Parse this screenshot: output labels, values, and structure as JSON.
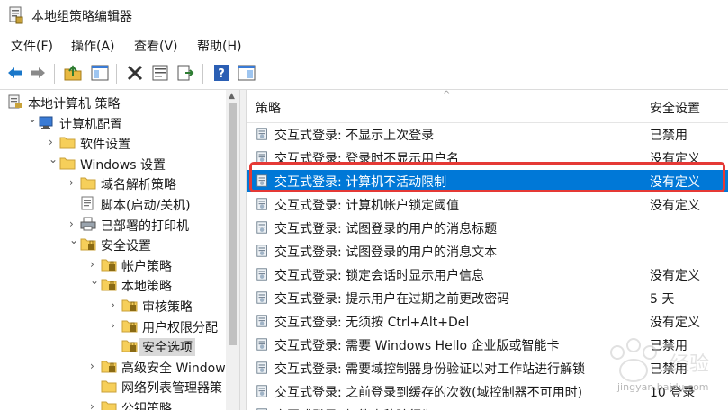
{
  "window": {
    "title": "本地组策略编辑器"
  },
  "menu": [
    "文件(F)",
    "操作(A)",
    "查看(V)",
    "帮助(H)"
  ],
  "tree": [
    {
      "label": "本地计算机 策略",
      "depth": 0,
      "chevron": "",
      "icon": "policy-doc-icon"
    },
    {
      "label": "计算机配置",
      "depth": 1,
      "chevron": "v",
      "icon": "computer-icon"
    },
    {
      "label": "软件设置",
      "depth": 2,
      "chevron": ">",
      "icon": "folder-icon"
    },
    {
      "label": "Windows 设置",
      "depth": 2,
      "chevron": "v",
      "icon": "folder-icon"
    },
    {
      "label": "域名解析策略",
      "depth": 3,
      "chevron": ">",
      "icon": "folder-icon"
    },
    {
      "label": "脚本(启动/关机)",
      "depth": 3,
      "chevron": "",
      "icon": "script-icon"
    },
    {
      "label": "已部署的打印机",
      "depth": 3,
      "chevron": ">",
      "icon": "printer-icon"
    },
    {
      "label": "安全设置",
      "depth": 3,
      "chevron": "v",
      "icon": "security-folder-icon"
    },
    {
      "label": "帐户策略",
      "depth": 4,
      "chevron": ">",
      "icon": "security-folder-icon"
    },
    {
      "label": "本地策略",
      "depth": 4,
      "chevron": "v",
      "icon": "security-folder-icon"
    },
    {
      "label": "审核策略",
      "depth": 5,
      "chevron": ">",
      "icon": "security-folder-icon"
    },
    {
      "label": "用户权限分配",
      "depth": 5,
      "chevron": ">",
      "icon": "security-folder-icon"
    },
    {
      "label": "安全选项",
      "depth": 5,
      "chevron": "",
      "icon": "security-folder-icon",
      "selected": true
    },
    {
      "label": "高级安全 Windows",
      "depth": 4,
      "chevron": ">",
      "icon": "security-folder-icon"
    },
    {
      "label": "网络列表管理器策",
      "depth": 4,
      "chevron": "",
      "icon": "folder-icon"
    },
    {
      "label": "公钥策略",
      "depth": 4,
      "chevron": ">",
      "icon": "folder-icon"
    }
  ],
  "list": {
    "col_policy": "策略",
    "col_setting": "安全设置",
    "rows": [
      {
        "name": "交互式登录: 不显示上次登录",
        "value": "已禁用"
      },
      {
        "name": "交互式登录: 登录时不显示用户名",
        "value": "没有定义"
      },
      {
        "name": "交互式登录: 计算机不活动限制",
        "value": "没有定义",
        "selected": true
      },
      {
        "name": "交互式登录: 计算机帐户锁定阈值",
        "value": "没有定义"
      },
      {
        "name": "交互式登录: 试图登录的用户的消息标题",
        "value": ""
      },
      {
        "name": "交互式登录: 试图登录的用户的消息文本",
        "value": ""
      },
      {
        "name": "交互式登录: 锁定会话时显示用户信息",
        "value": "没有定义"
      },
      {
        "name": "交互式登录: 提示用户在过期之前更改密码",
        "value": "5 天"
      },
      {
        "name": "交互式登录: 无须按 Ctrl+Alt+Del",
        "value": "没有定义"
      },
      {
        "name": "交互式登录: 需要 Windows Hello 企业版或智能卡",
        "value": "已禁用"
      },
      {
        "name": "交互式登录: 需要域控制器身份验证以对工作站进行解锁",
        "value": "已禁用"
      },
      {
        "name": "交互式登录: 之前登录到缓存的次数(域控制器不可用时)",
        "value": "10 登录"
      },
      {
        "name": "交互式登录: 智能卡移除行为",
        "value": ""
      }
    ]
  },
  "watermark": {
    "text": "jingyan.baidu.com"
  },
  "colors": {
    "selection": "#0078d7",
    "highlight_border": "#e53935"
  }
}
